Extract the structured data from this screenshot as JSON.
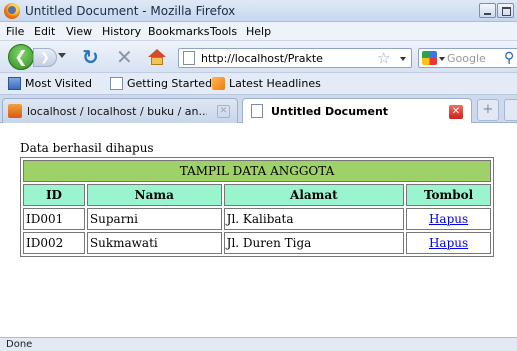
{
  "window": {
    "title": "Untitled Document - Mozilla Firefox"
  },
  "menu": [
    {
      "label": "File"
    },
    {
      "label": "Edit"
    },
    {
      "label": "View"
    },
    {
      "label": "History"
    },
    {
      "label": "Bookmarks"
    },
    {
      "label": "Tools"
    },
    {
      "label": "Help"
    }
  ],
  "nav": {
    "url": "http://localhost/Prakte",
    "search_placeholder": "Google"
  },
  "bookmarks": [
    {
      "label": "Most Visited",
      "icon": "most-visited-icon"
    },
    {
      "label": "Getting Started",
      "icon": "page-icon"
    },
    {
      "label": "Latest Headlines",
      "icon": "rss-icon"
    }
  ],
  "tabs": [
    {
      "label": "localhost / localhost / buku / an...",
      "active": false
    },
    {
      "label": "Untitled Document",
      "active": true
    }
  ],
  "page": {
    "message": "Data berhasil dihapus",
    "table_title": "TAMPIL DATA ANGGOTA",
    "columns": [
      "ID",
      "Nama",
      "Alamat",
      "Tombol"
    ],
    "rows": [
      {
        "id": "ID001",
        "nama": "Suparni",
        "alamat": "Jl. Kalibata",
        "action": "Hapus"
      },
      {
        "id": "ID002",
        "nama": "Sukmawati",
        "alamat": "Jl. Duren Tiga",
        "action": "Hapus"
      }
    ]
  },
  "status": {
    "text": "Done"
  },
  "colors": {
    "title_row": "#9ed168",
    "header_row": "#9af5cf",
    "link": "#0000ee"
  }
}
